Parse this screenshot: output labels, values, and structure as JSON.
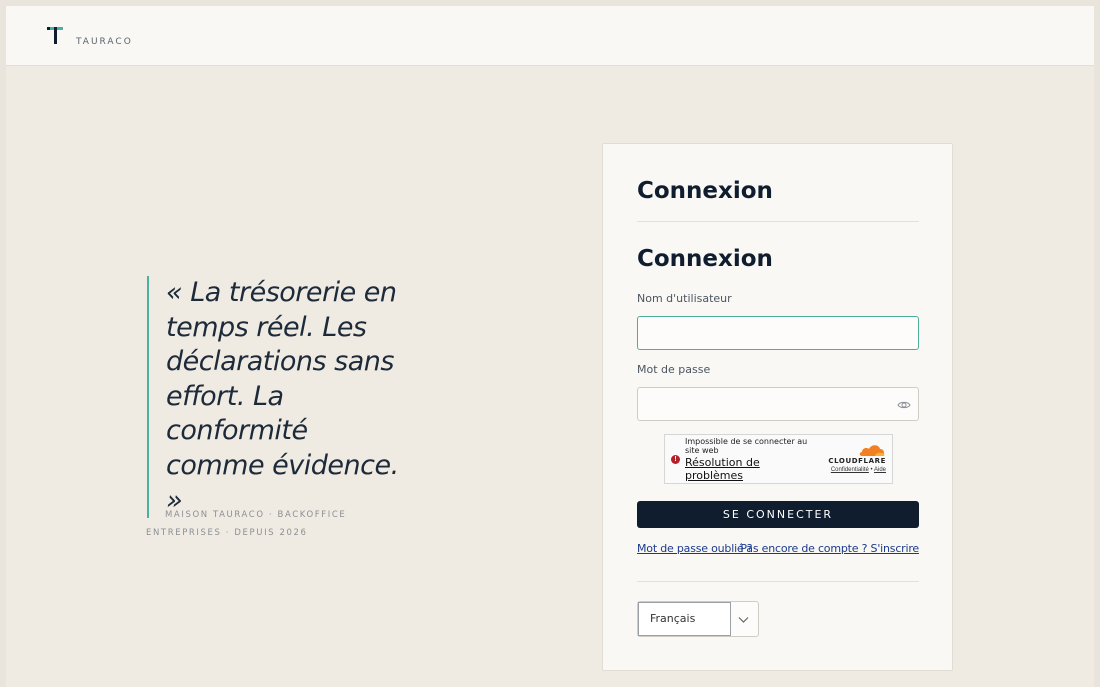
{
  "brand": {
    "name": "TAURACO",
    "accent": "#4ab0a0",
    "dark": "#0f1d2e"
  },
  "quote": {
    "text": "« La trésorerie en temps réel. Les déclarations sans effort. La conformité comme évidence. »"
  },
  "tagline": "MAISON TAURACO · BACKOFFICE ENTREPRISES · DEPUIS 2026",
  "card": {
    "title": "Connexion",
    "form_title": "Connexion",
    "username_label": "Nom d'utilisateur",
    "username_value": "",
    "password_label": "Mot de passe",
    "password_value": "",
    "captcha": {
      "message": "Impossible de se connecter au site web",
      "link": "Résolution de problèmes",
      "brand": "CLOUDFLARE",
      "privacy": "Confidentialité",
      "separator": "•",
      "help": "Aide"
    },
    "submit_label": "SE CONNECTER",
    "forgot_link": "Mot de passe oublié ?",
    "signup_link": "Pas encore de compte ? S'inscrire",
    "language": "Français"
  }
}
